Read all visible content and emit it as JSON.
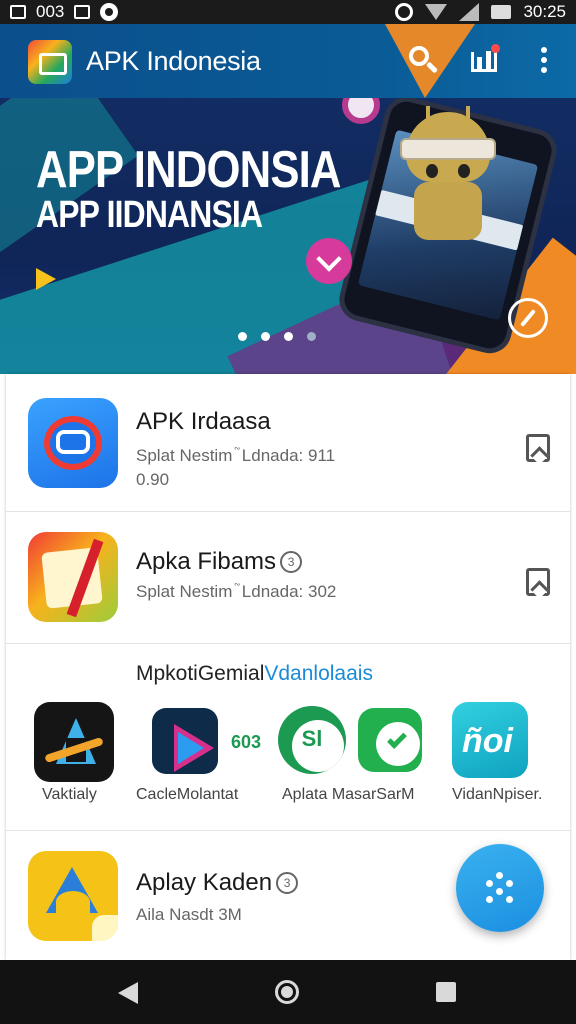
{
  "status_bar": {
    "time_left": "003",
    "time_right": "30:25"
  },
  "app_bar": {
    "title": "APK Indonesia",
    "icons": [
      "app-logo",
      "search-icon",
      "chart-icon",
      "more-vert-icon"
    ]
  },
  "hero": {
    "headline": "APP INDONSIA",
    "subheadline": "APP IIDNANSIA",
    "carousel_dots": 4,
    "active_dot": 0
  },
  "list": {
    "items": [
      {
        "title": "APK Irdaasa",
        "subtitle_line1": "Splat Nestim ֘ Ldnada: 911",
        "subtitle_line2": "0.90",
        "badge": ""
      },
      {
        "title": "Apka Fibams",
        "subtitle_line1": "Splat Nestim ֘ Ldnada: 302",
        "subtitle_line2": "",
        "badge": "3"
      }
    ],
    "section": {
      "title_plain": "MpkotiGemial",
      "title_accent": "Vdanlolaais",
      "tiles": [
        {
          "label": "Vaktialy"
        },
        {
          "label": "CacleMolantat"
        },
        {
          "label": ""
        },
        {
          "label": "Aplata MasarSarM"
        },
        {
          "label": "VidanNpiser."
        }
      ],
      "mini_badge": "603"
    },
    "bottom_item": {
      "title": "Aplay Kaden",
      "subtitle": "Aila Nasdt 3M",
      "badge": "3"
    }
  },
  "colors": {
    "app_bar": "#0b4f8c",
    "accent_orange": "#f08a24",
    "accent_blue": "#1a8bd6",
    "fab": "#1b8fe0"
  }
}
